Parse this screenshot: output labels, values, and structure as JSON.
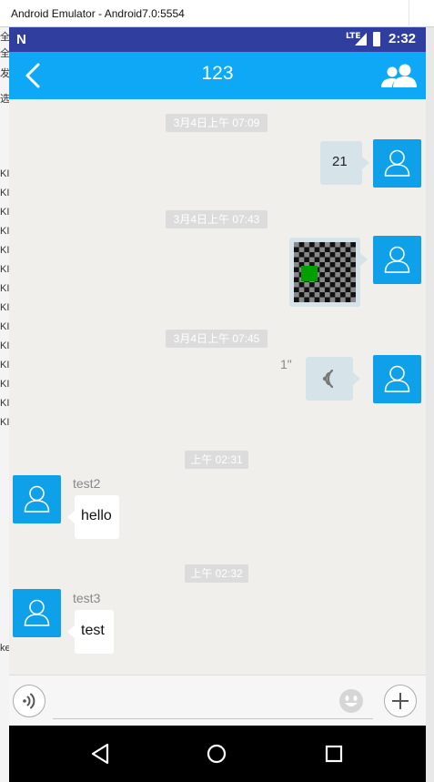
{
  "window": {
    "title": "Android Emulator - Android7.0:5554"
  },
  "left_strip": {
    "chars": [
      "全",
      "全",
      "发",
      "选",
      "KI",
      "KI",
      "KI",
      "KI",
      "KI",
      "KI",
      "KI",
      "KI",
      "KI",
      "KI",
      "KI",
      "KI",
      "KI",
      "KI",
      "ke"
    ]
  },
  "status_bar": {
    "time": "2:32",
    "network": "LTE"
  },
  "app_bar": {
    "title": "123"
  },
  "messages": [
    {
      "timestamp": "3月4日上午 07:09",
      "text": "21"
    },
    {
      "timestamp": "3月4日上午 07:43"
    },
    {
      "timestamp": "3月4日上午 07:45",
      "duration": "1\""
    },
    {
      "timestamp": "上午 02:31",
      "sender": "test2",
      "text": "hello"
    },
    {
      "timestamp": "上午 02:32",
      "sender": "test3",
      "text": "test"
    }
  ],
  "colors": {
    "accent": "#0ea8f6",
    "status_bar": "#303f9f",
    "avatar": "#0ea0e8",
    "chat_bg": "#f0efeb",
    "outgoing_bubble": "#d6e4ea",
    "incoming_bubble": "#ffffff",
    "image_square": "#00a000"
  },
  "icons": [
    "voice-toggle-icon",
    "emoji-icon",
    "plus-icon",
    "back-arrow-icon",
    "group-icon",
    "sound-wave-icon",
    "user-icon"
  ]
}
